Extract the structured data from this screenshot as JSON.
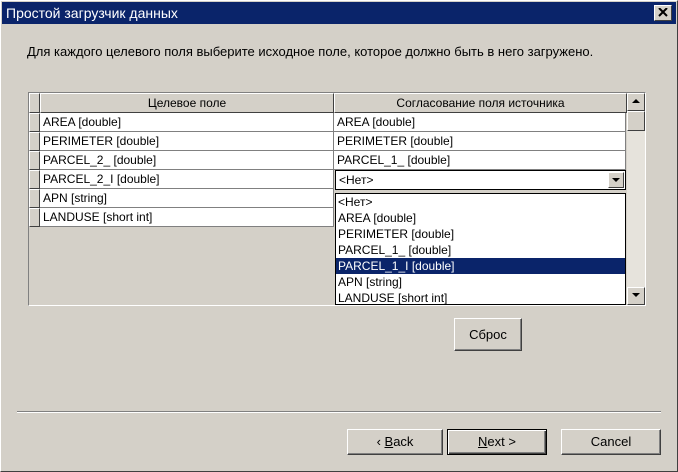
{
  "window": {
    "title": "Простой загрузчик данных",
    "close_label": "×"
  },
  "instruction": "Для каждого целевого поля выберите исходное поле, которое должно быть в него загружено.",
  "grid": {
    "headers": [
      "Целевое поле",
      "Согласование поля источника"
    ],
    "rows": [
      {
        "target": "AREA [double]",
        "source": "AREA [double]"
      },
      {
        "target": "PERIMETER [double]",
        "source": "PERIMETER [double]"
      },
      {
        "target": "PARCEL_2_ [double]",
        "source": "PARCEL_1_ [double]"
      },
      {
        "target": "PARCEL_2_I [double]",
        "source": "<Нет>"
      },
      {
        "target": "APN [string]",
        "source": ""
      },
      {
        "target": "LANDUSE [short int]",
        "source": ""
      }
    ],
    "combo_value": "<Нет>",
    "dropdown_options": [
      "<Нет>",
      "AREA [double]",
      "PERIMETER [double]",
      "PARCEL_1_ [double]",
      "PARCEL_1_I [double]",
      "APN [string]",
      "LANDUSE [short int]"
    ],
    "dropdown_selected": "PARCEL_1_I [double]"
  },
  "buttons": {
    "reset": "Сброс",
    "back_accel": "B",
    "back_rest": "ack",
    "next_accel": "N",
    "next_rest": "ext >",
    "cancel": "Cancel"
  },
  "colors": {
    "face": "#d4d0c8",
    "title_bar": "#0a246a",
    "selection": "#0a246a"
  }
}
